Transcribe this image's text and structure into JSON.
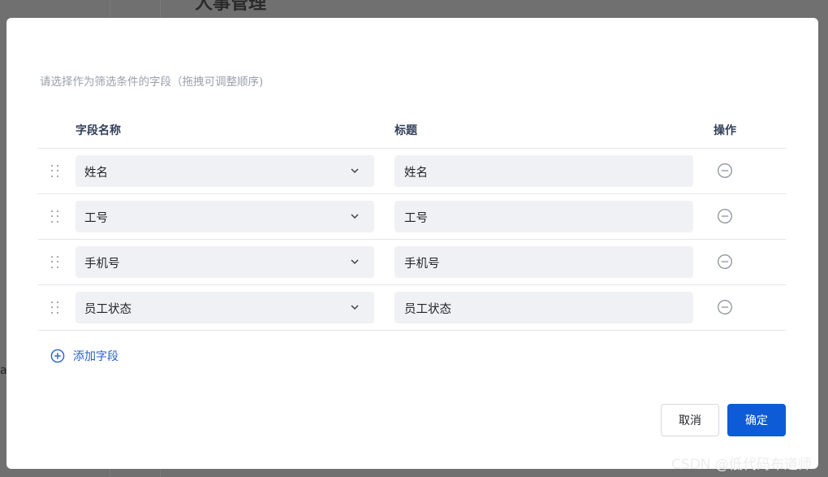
{
  "background": {
    "title_fragment": "人事管理",
    "left_fragment": "a"
  },
  "dialog": {
    "hint": "请选择作为筛选条件的字段（拖拽可调整顺序)",
    "columns": {
      "field_name": "字段名称",
      "title": "标题",
      "action": "操作"
    },
    "rows": [
      {
        "field": "姓名",
        "title": "姓名"
      },
      {
        "field": "工号",
        "title": "工号"
      },
      {
        "field": "手机号",
        "title": "手机号"
      },
      {
        "field": "员工状态",
        "title": "员工状态"
      }
    ],
    "add_field_label": "添加字段",
    "cancel_label": "取消",
    "confirm_label": "确定"
  },
  "watermark": "CSDN @低代码布道师",
  "colors": {
    "primary": "#0d5bd6",
    "link": "#2660c9",
    "field_bg": "#f0f1f5",
    "overlay": "#6b6b6b"
  },
  "icons": {
    "drag": "drag-handle-icon",
    "dropdown": "chevron-down-icon",
    "remove": "minus-circle-icon",
    "add": "plus-circle-icon"
  }
}
